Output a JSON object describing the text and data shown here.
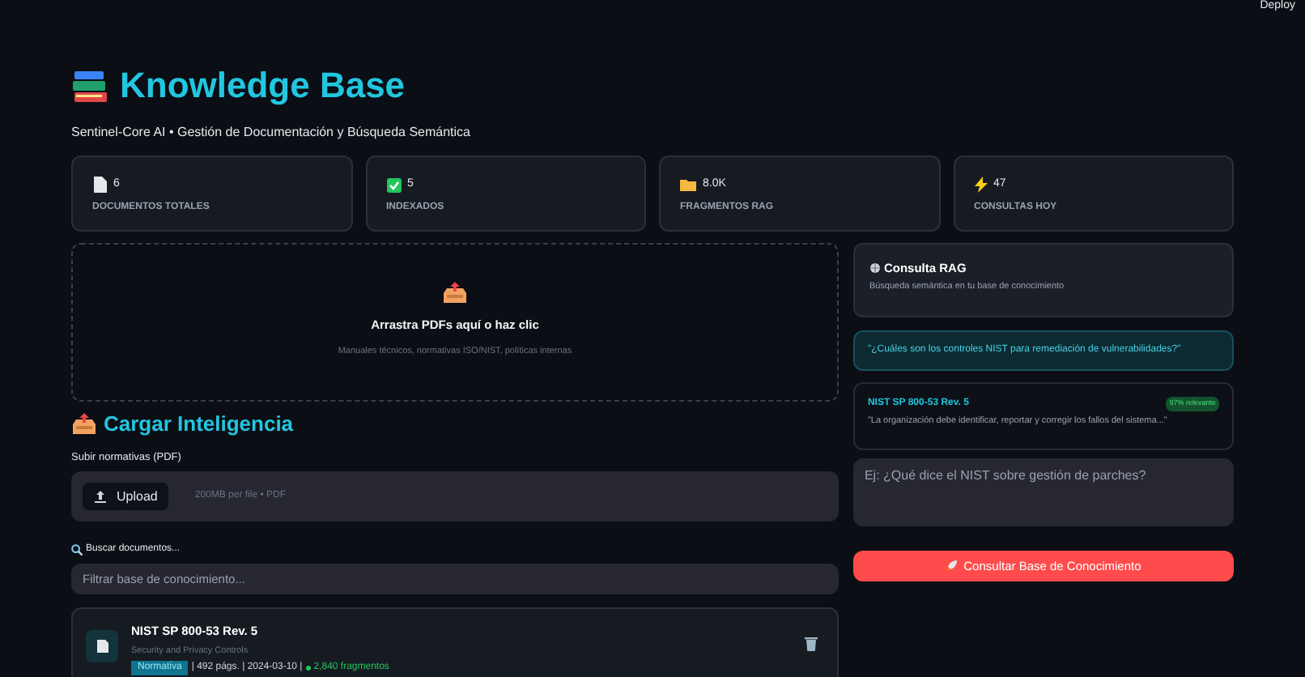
{
  "header": {
    "deploy": "Deploy",
    "title": "Knowledge Base",
    "subtitle": "Sentinel-Core AI • Gestión de Documentación y Búsqueda Semántica"
  },
  "stats": [
    {
      "kind": "doc",
      "value": "6",
      "label": "DOCUMENTOS TOTALES"
    },
    {
      "kind": "check",
      "value": "5",
      "label": "INDEXADOS"
    },
    {
      "kind": "folder",
      "value": "8.0K",
      "label": "FRAGMENTOS RAG"
    },
    {
      "kind": "bolt",
      "value": "47",
      "label": "CONSULTAS HOY"
    }
  ],
  "dropzone": {
    "title": "Arrastra PDFs aquí o haz clic",
    "hint": "Manuales técnicos, normativas ISO/NIST, políticas internas"
  },
  "upload_section": {
    "heading": "Cargar Inteligencia",
    "label": "Subir normativas (PDF)",
    "button": "Upload",
    "limit": "200MB per file • PDF"
  },
  "search": {
    "label": "Buscar documentos...",
    "placeholder": "Filtrar base de conocimiento..."
  },
  "documents": [
    {
      "title": "NIST SP 800-53 Rev. 5",
      "subtitle": "Security and Privacy Controls",
      "tag": "Normativa",
      "meta": "| 492 págs. | 2024-03-10 |",
      "fragments": "2,840 fragmentos"
    }
  ],
  "rag": {
    "title": "Consulta RAG",
    "subtitle": "Búsqueda semántica en tu base de conocimiento",
    "example_query": "\"¿Cuáles son los controles NIST para remediación de vulnerabilidades?\"",
    "result": {
      "source": "NIST SP 800-53 Rev. 5",
      "relevance": "97% relevante",
      "excerpt": "\"La organización debe identificar, reportar y corregir los fallos del sistema...\""
    },
    "placeholder": "Ej: ¿Qué dice el NIST sobre gestión de parches?",
    "button": "Consultar Base de Conocimiento"
  }
}
